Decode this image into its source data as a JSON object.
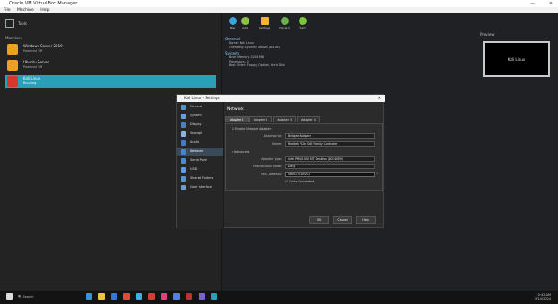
{
  "window": {
    "title": "Oracle VM VirtualBox Manager",
    "minimize": "—",
    "close": "✕"
  },
  "menu": [
    "File",
    "Machine",
    "Help"
  ],
  "tools": {
    "label": "Tools"
  },
  "vm_list": {
    "header": "Machines",
    "items": [
      {
        "name": "Windows Server 2019",
        "state": "Powered Off",
        "color": "#f0a020"
      },
      {
        "name": "Ubuntu Server",
        "state": "Powered Off",
        "color": "#f0a020"
      },
      {
        "name": "Kali Linux",
        "state": "Running",
        "color": "#d8372c",
        "selected": true
      }
    ]
  },
  "toolbar": [
    {
      "label": "New",
      "color": "#36a7de"
    },
    {
      "label": "Add",
      "color": "#8bc34a"
    },
    {
      "label": "Settings",
      "color": "#f3b431"
    },
    {
      "label": "Discard",
      "color": "#6ab04c"
    },
    {
      "label": "Start",
      "color": "#7cc43e"
    }
  ],
  "details": [
    {
      "section": "General",
      "rows": [
        "Name: Kali Linux",
        "Operating System: Debian (64-bit)"
      ]
    },
    {
      "section": "System",
      "rows": [
        "Base Memory: 2048 MB",
        "Processors: 2",
        "Boot Order: Floppy, Optical, Hard Disk"
      ]
    }
  ],
  "preview": {
    "header": "Preview",
    "screen_text": "Kali Linux"
  },
  "dialog": {
    "title": "Kali Linux - Settings",
    "close": "✕",
    "page_title": "Network",
    "nav": [
      {
        "label": "General",
        "color": "#5b8fd0"
      },
      {
        "label": "System",
        "color": "#6aa0d8"
      },
      {
        "label": "Display",
        "color": "#4a7fc0"
      },
      {
        "label": "Storage",
        "color": "#8ab4e0"
      },
      {
        "label": "Audio",
        "color": "#3d7ec9"
      },
      {
        "label": "Network",
        "color": "#3f86d6",
        "active": true
      },
      {
        "label": "Serial Ports",
        "color": "#4a8bd5"
      },
      {
        "label": "USB",
        "color": "#5a9ee6"
      },
      {
        "label": "Shared Folders",
        "color": "#5f8fd0"
      },
      {
        "label": "User Interface",
        "color": "#6a9ad8"
      }
    ],
    "tabs": [
      "Adapter 1",
      "Adapter 2",
      "Adapter 3",
      "Adapter 4"
    ],
    "enable_label": "Enable Network Adapter",
    "attached_label": "Attached to:",
    "attached_value": "Bridged Adapter",
    "name_label": "Name:",
    "name_value": "Realtek PCIe GbE Family Controller",
    "advanced_label": "Advanced",
    "type_label": "Adapter Type:",
    "type_value": "Intel PRO/1000 MT Desktop (82540EM)",
    "promisc_label": "Promiscuous Mode:",
    "promisc_value": "Deny",
    "mac_label": "MAC Address:",
    "mac_value": "080027A1B2C3",
    "cable_label": "Cable Connected",
    "buttons": [
      "OK",
      "Cancel",
      "Help"
    ]
  },
  "taskbar": {
    "search": "Search",
    "apps": [
      "#3c8ee0",
      "#f0c040",
      "#2a7ad6",
      "#e04a3a",
      "#3cb0e0",
      "#d0402c",
      "#e04080",
      "#5080e0",
      "#c03030",
      "#7a60d0",
      "#2aa0b8"
    ],
    "time": "10:42 AM",
    "date": "5/14/2024"
  }
}
